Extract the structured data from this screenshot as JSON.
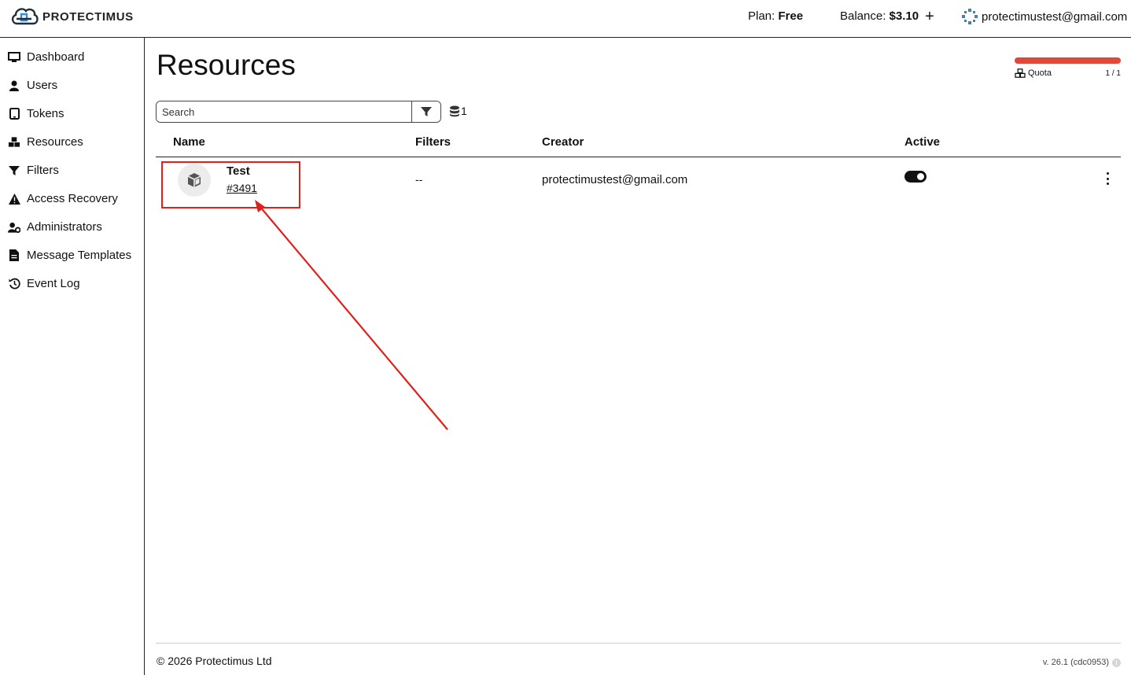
{
  "app": {
    "logo_text": "PROTECTIMUS"
  },
  "header": {
    "plan_label": "Plan:",
    "plan_value": "Free",
    "balance_label": "Balance:",
    "balance_value": "$3.10",
    "user_email": "protectimustest@gmail.com"
  },
  "sidebar": {
    "items": [
      {
        "label": "Dashboard",
        "icon": "monitor-icon"
      },
      {
        "label": "Users",
        "icon": "user-icon"
      },
      {
        "label": "Tokens",
        "icon": "tablet-icon"
      },
      {
        "label": "Resources",
        "icon": "cubes-icon"
      },
      {
        "label": "Filters",
        "icon": "filter-icon"
      },
      {
        "label": "Access Recovery",
        "icon": "warning-icon"
      },
      {
        "label": "Administrators",
        "icon": "user-cog-icon"
      },
      {
        "label": "Message Templates",
        "icon": "document-icon"
      },
      {
        "label": "Event Log",
        "icon": "history-icon"
      }
    ]
  },
  "main": {
    "title": "Resources",
    "quota": {
      "label": "Quota",
      "count": "1 / 1",
      "fill_fraction": 1.0,
      "color": "#e2483a"
    },
    "search": {
      "placeholder": "Search",
      "value": ""
    },
    "resource_count": "1",
    "table": {
      "columns": [
        "Name",
        "Filters",
        "Creator",
        "Active"
      ],
      "rows": [
        {
          "name": "Test",
          "id": "#3491",
          "filters": "--",
          "creator": "protectimustest@gmail.com",
          "active": true
        }
      ]
    }
  },
  "annotation": {
    "color": "#e0201b"
  },
  "footer": {
    "copyright": "© 2026 Protectimus Ltd",
    "version": "v. 26.1 (cdc0953)"
  }
}
